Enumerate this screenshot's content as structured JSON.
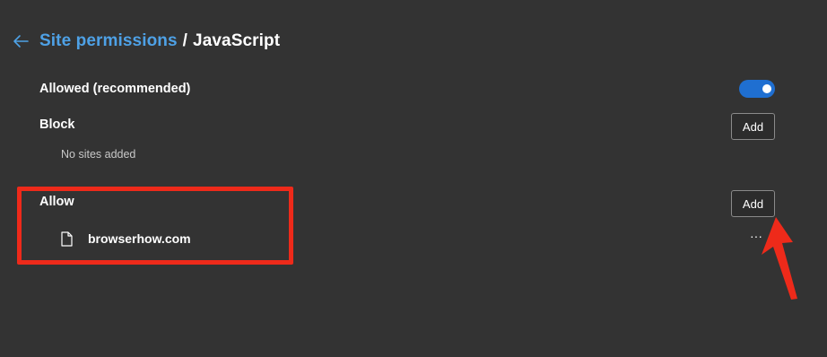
{
  "header": {
    "back_icon": "arrow-left-icon",
    "breadcrumb_parent": "Site permissions",
    "separator": "/",
    "breadcrumb_current": "JavaScript"
  },
  "allowed": {
    "label": "Allowed (recommended)",
    "toggle_on": true
  },
  "block": {
    "label": "Block",
    "add_label": "Add",
    "empty_text": "No sites added"
  },
  "allow": {
    "label": "Allow",
    "add_label": "Add",
    "sites": [
      {
        "icon": "file-icon",
        "name": "browserhow.com",
        "more_label": "···"
      }
    ]
  },
  "colors": {
    "background": "#333333",
    "accent_link": "#4ea1e6",
    "toggle_on": "#1f6fd1",
    "annotation_red": "#ee2a1a"
  }
}
